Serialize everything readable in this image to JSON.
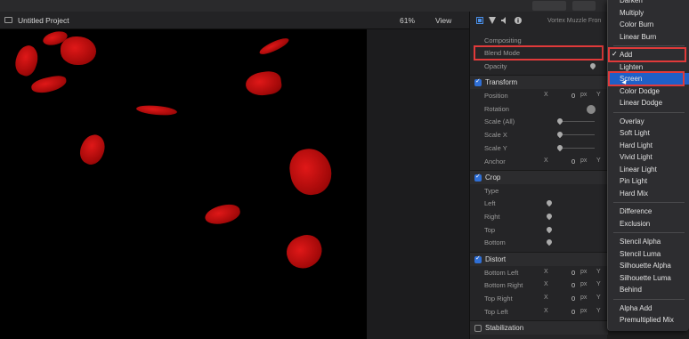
{
  "viewer": {
    "project_title": "Untitled Project",
    "zoom": "61%",
    "view_label": "View"
  },
  "inspector": {
    "title": "Vortex Muzzle Fron",
    "compositing": {
      "header": "Compositing",
      "blend_mode_label": "Blend Mode",
      "opacity_label": "Opacity"
    },
    "transform": {
      "header": "Transform",
      "position_label": "Position",
      "position_x_axis": "X",
      "position_x_value": "0",
      "position_unit": "px",
      "position_y_axis": "Y",
      "rotation_label": "Rotation",
      "scale_all_label": "Scale (All)",
      "scale_x_label": "Scale X",
      "scale_y_label": "Scale Y",
      "anchor_label": "Anchor",
      "anchor_x_axis": "X",
      "anchor_x_value": "0",
      "anchor_unit": "px",
      "anchor_y_axis": "Y"
    },
    "crop": {
      "header": "Crop",
      "type_label": "Type",
      "left_label": "Left",
      "right_label": "Right",
      "top_label": "Top",
      "bottom_label": "Bottom"
    },
    "distort": {
      "header": "Distort",
      "rows": [
        {
          "label": "Bottom Left",
          "x": "X",
          "value": "0",
          "unit": "px",
          "y": "Y"
        },
        {
          "label": "Bottom Right",
          "x": "X",
          "value": "0",
          "unit": "px",
          "y": "Y"
        },
        {
          "label": "Top Right",
          "x": "X",
          "value": "0",
          "unit": "px",
          "y": "Y"
        },
        {
          "label": "Top Left",
          "x": "X",
          "value": "0",
          "unit": "px",
          "y": "Y"
        }
      ]
    },
    "stabilization": {
      "header": "Stabilization"
    }
  },
  "blend_menu": {
    "items": [
      "Darken",
      "Multiply",
      "Color Burn",
      "Linear Burn",
      "Add",
      "Lighten",
      "Screen",
      "Color Dodge",
      "Linear Dodge",
      "Overlay",
      "Soft Light",
      "Hard Light",
      "Vivid Light",
      "Linear Light",
      "Pin Light",
      "Hard Mix",
      "Difference",
      "Exclusion",
      "Stencil Alpha",
      "Stencil Luma",
      "Silhouette Alpha",
      "Silhouette Luma",
      "Behind",
      "Alpha Add",
      "Premultiplied Mix"
    ],
    "checked_item": "Add",
    "checkmark": "✓",
    "highlighted_item": "Screen"
  },
  "colors": {
    "accent": "#1f5fc7",
    "highlight_box": "#e03a3a",
    "petal": "#d01010"
  }
}
